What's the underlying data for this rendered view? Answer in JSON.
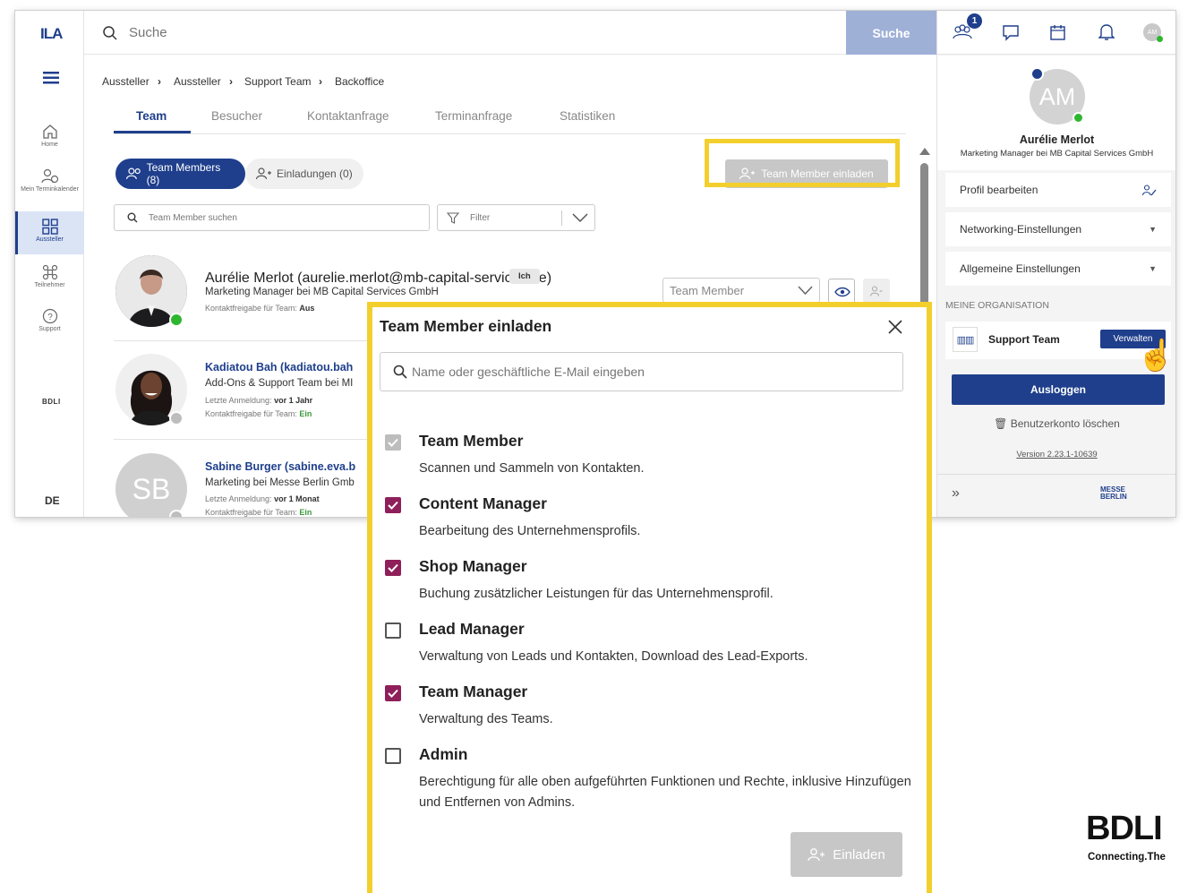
{
  "brand": {
    "logo_text": "ILA",
    "accent": "#1f3f8c",
    "highlight": "#f3cf2e",
    "check_color": "#8f1f5a"
  },
  "topbar": {
    "search_placeholder": "Suche",
    "search_button": "Suche",
    "notification_count": "1"
  },
  "rail": {
    "items": [
      {
        "label": "Home",
        "icon": "home-icon"
      },
      {
        "label": "Mein Terminkalender",
        "icon": "calendar-person-icon"
      },
      {
        "label": "Aussteller",
        "icon": "grid-icon"
      },
      {
        "label": "Teilnehmer",
        "icon": "network-icon"
      },
      {
        "label": "Support",
        "icon": "help-icon"
      }
    ],
    "partner_logo": "BDLI",
    "language": "DE"
  },
  "breadcrumb": [
    "Aussteller",
    "Aussteller",
    "Support Team",
    "Backoffice"
  ],
  "tabs": [
    "Team",
    "Besucher",
    "Kontaktanfrage",
    "Terminanfrage",
    "Statistiken"
  ],
  "pills": {
    "members": "Team Members (8)",
    "invitations": "Einladungen (0)"
  },
  "invite_button": "Team Member einladen",
  "member_search_placeholder": "Team Member suchen",
  "filter_placeholder": "Filter",
  "members": [
    {
      "name": "Aurélie Merlot (aurelie.merlot@mb-capital-services.de)",
      "badge": "Ich",
      "subtitle": "Marketing Manager bei MB Capital Services GmbH",
      "meta_label": "Kontaktfreigabe für Team:",
      "meta_value": "Aus",
      "role": "Team Member"
    },
    {
      "name": "Kadiatou Bah (kadiatou.bah",
      "subtitle": "Add-Ons & Support Team bei MI",
      "login_label": "Letzte Anmeldung:",
      "login_value": "vor 1 Jahr",
      "meta_label": "Kontaktfreigabe für Team:",
      "meta_value": "Ein"
    },
    {
      "name": "Sabine Burger (sabine.eva.b",
      "initials": "SB",
      "subtitle": "Marketing bei Messe Berlin Gmb",
      "login_label": "Letzte Anmeldung:",
      "login_value": "vor 1 Monat",
      "meta_label": "Kontaktfreigabe für Team:",
      "meta_value": "Ein"
    }
  ],
  "profile": {
    "initials": "AM",
    "name": "Aurélie Merlot",
    "subtitle": "Marketing Manager bei MB Capital Services GmbH",
    "edit": "Profil bearbeiten",
    "networking": "Networking-Einstellungen",
    "general": "Allgemeine Einstellungen",
    "org_heading": "MEINE ORGANISATION",
    "org_name": "Support Team",
    "manage": "Verwalten",
    "logout": "Ausloggen",
    "delete": "Benutzerkonto löschen",
    "version": "Version 2.23.1-10639",
    "footer_logo": "MESSE BERLIN"
  },
  "modal": {
    "title": "Team Member einladen",
    "search_placeholder": "Name oder geschäftliche E-Mail eingeben",
    "options": [
      {
        "title": "Team Member",
        "desc": "Scannen und Sammeln von Kontakten.",
        "state": "disabled"
      },
      {
        "title": "Content Manager",
        "desc": "Bearbeitung des Unternehmensprofils.",
        "state": "checked"
      },
      {
        "title": "Shop Manager",
        "desc": "Buchung zusätzlicher Leistungen für das Unternehmensprofil.",
        "state": "checked"
      },
      {
        "title": "Lead Manager",
        "desc": "Verwaltung von Leads und Kontakten, Download des Lead-Exports.",
        "state": "unchecked"
      },
      {
        "title": "Team Manager",
        "desc": "Verwaltung des Teams.",
        "state": "checked"
      },
      {
        "title": "Admin",
        "desc": "Berechtigung für alle oben aufgeführten Funktionen und Rechte, inklusive Hinzufügen und Entfernen von Admins.",
        "state": "unchecked"
      }
    ],
    "submit": "Einladen"
  },
  "corner_logo": {
    "mark": "BDLI",
    "tagline": "Connecting.The"
  }
}
